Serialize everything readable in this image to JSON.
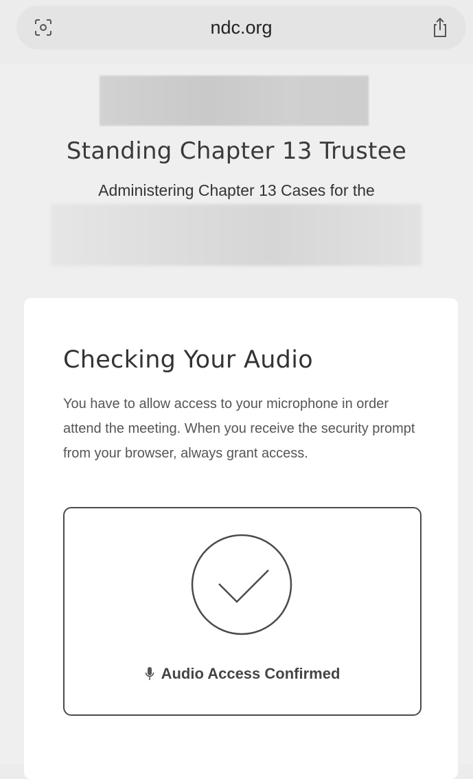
{
  "browser": {
    "url": "ndc.org",
    "left_icon": "screen-capture-icon",
    "right_icon": "share-icon"
  },
  "header": {
    "title": "Standing Chapter 13 Trustee",
    "subtitle": "Administering Chapter 13 Cases for the"
  },
  "card": {
    "title": "Checking Your Audio",
    "body": "You have to allow access to your microphone in order attend the meeting. When you receive the security prompt from your browser, always grant access.",
    "status_icon": "checkmark-circle-icon",
    "status_label": "Audio Access Confirmed",
    "mic_icon": "microphone-icon"
  }
}
